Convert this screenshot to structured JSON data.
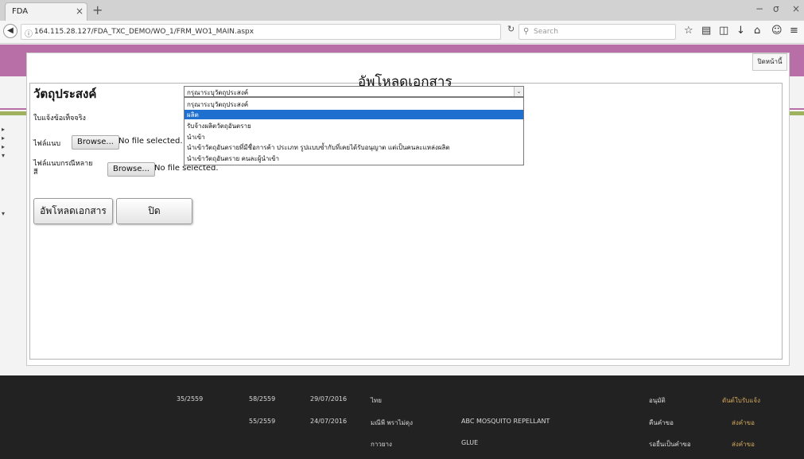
{
  "browser": {
    "tab_title": "FDA",
    "tab_close": "×",
    "new_tab": "+",
    "url": "164.115.28.127/FDA_TXC_DEMO/WO_1/FRM_WO1_MAIN.aspx",
    "search_placeholder": "Search",
    "window_controls": [
      "−",
      "σ",
      "×"
    ],
    "toolbar_icons": [
      "star-icon",
      "reading-list-icon",
      "pocket-icon",
      "download-icon",
      "home-icon",
      "account-icon",
      "menu-icon"
    ]
  },
  "modal": {
    "close_page_label": "ปิดหน้านี้",
    "title": "อัพโหลดเอกสาร",
    "purpose_label": "วัตถุประสงค์",
    "select": {
      "selected_value": "กรุณาระบุวัตถุประสงค์",
      "options": [
        "กรุณาระบุวัตถุประสงค์",
        "ผลิต",
        "รับจ้างผลิตวัตถุอันตราย",
        "นำเข้า",
        "นำเข้าวัตถุอันตรายที่มีชื่อการค้า ประเภท รูปแบบซ้ำกับที่เคยได้รับอนุญาต แต่เป็นคนละแหล่งผลิต",
        "นำเข้าวัตถุอันตราย คนละผู้นำเข้า"
      ],
      "highlighted_index": 1
    },
    "fact_sheet_label": "ใบแจ้งข้อเท็จจริง",
    "attachment_label": "ไฟล์แนบ",
    "attachment_multi_label_line1": "ไฟล์แนบกรณีหลาย",
    "attachment_multi_label_line2": "สี",
    "browse_label": "Browse...",
    "no_file_text": "No file selected.",
    "upload_button": "อัพโหลดเอกสาร",
    "close_button": "ปิด"
  },
  "background_rows": [
    {
      "cells": [
        "35/2559",
        "58/2559",
        "29/07/2016",
        "ไทย",
        "",
        "อนุมัติ",
        "ดันต์ใบรับแจ้ง"
      ]
    },
    {
      "cells": [
        "",
        "55/2559",
        "24/07/2016",
        "มณีพี พราไม่ดุง",
        "ABC MOSQUITO REPELLANT",
        "คืนคำขอ",
        "ส่งคำขอ"
      ]
    },
    {
      "cells": [
        "",
        "",
        "",
        "กาวยาง",
        "GLUE",
        "รอยื่นเป็นคำขอ",
        "ส่งคำขอ"
      ]
    }
  ]
}
